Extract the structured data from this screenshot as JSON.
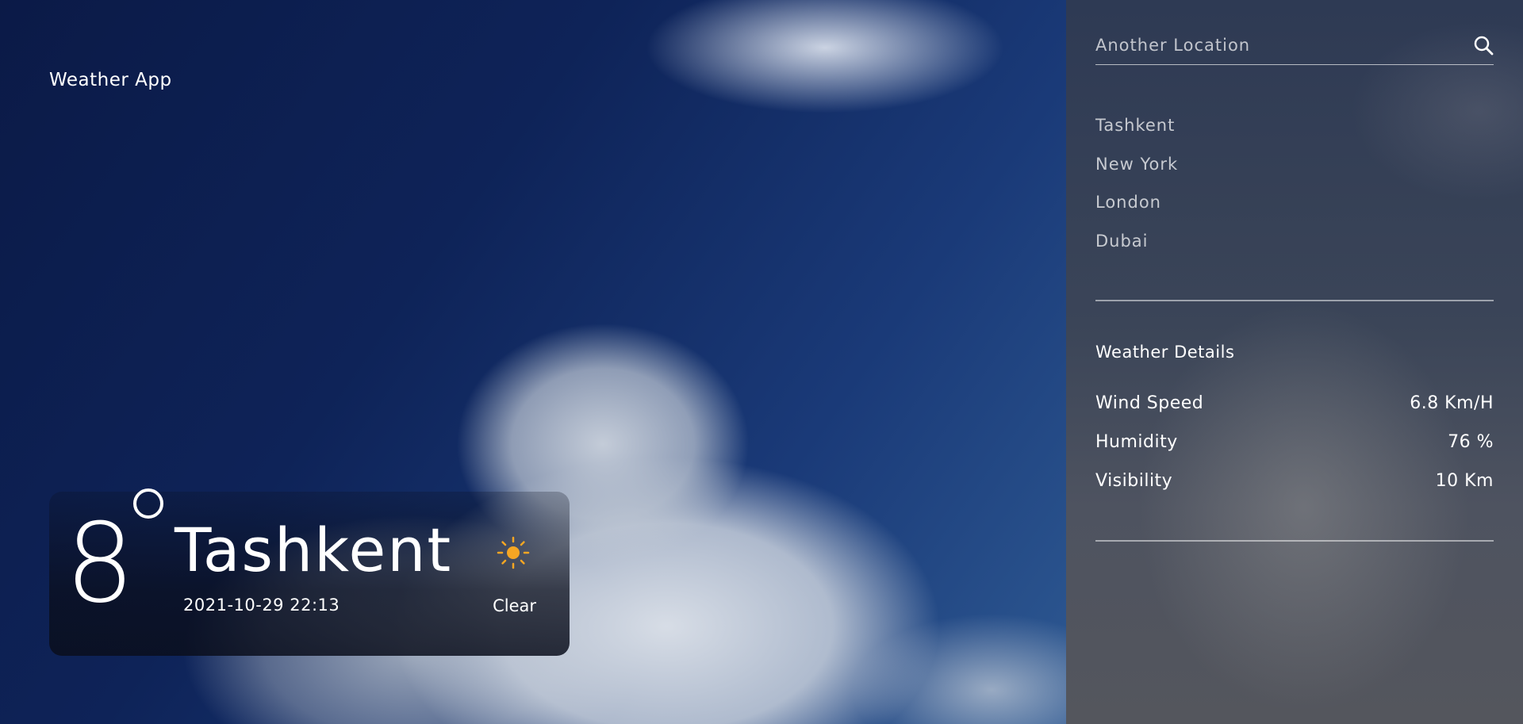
{
  "app": {
    "brand": "Weather App"
  },
  "current": {
    "temperature": "8",
    "city": "Tashkent",
    "datetime": "2021-10-29 22:13",
    "condition": "Clear",
    "condition_icon": "sun-icon",
    "accent_color": "#f5a623"
  },
  "search": {
    "placeholder": "Another Location",
    "value": "",
    "icon": "search-icon"
  },
  "locations": [
    {
      "label": "Tashkent"
    },
    {
      "label": "New York"
    },
    {
      "label": "London"
    },
    {
      "label": "Dubai"
    }
  ],
  "details": {
    "title": "Weather Details",
    "rows": [
      {
        "label": "Wind Speed",
        "value": "6.8 Km/H"
      },
      {
        "label": "Humidity",
        "value": "76 %"
      },
      {
        "label": "Visibility",
        "value": "10 Km"
      }
    ]
  }
}
